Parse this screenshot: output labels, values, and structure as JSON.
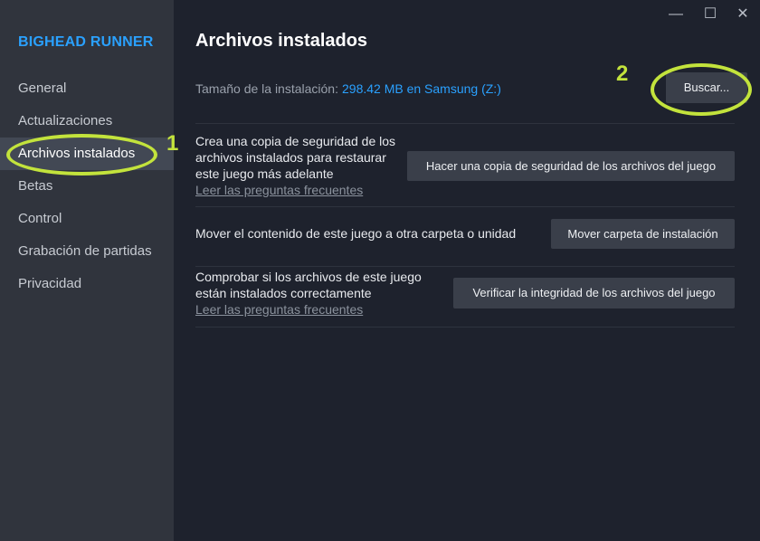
{
  "app": {
    "title": "BIGHEAD RUNNER"
  },
  "sidebar": {
    "items": [
      {
        "label": "General"
      },
      {
        "label": "Actualizaciones"
      },
      {
        "label": "Archivos instalados"
      },
      {
        "label": "Betas"
      },
      {
        "label": "Control"
      },
      {
        "label": "Grabación de partidas"
      },
      {
        "label": "Privacidad"
      }
    ],
    "active_index": 2
  },
  "window_controls": {
    "minimize": "—",
    "maximize": "☐",
    "close": "✕"
  },
  "main": {
    "title": "Archivos instalados",
    "install_size_label": "Tamaño de la instalación:",
    "install_size_value": "298.42 MB en Samsung (Z:)",
    "browse_button": "Buscar...",
    "sections": [
      {
        "text": "Crea una copia de seguridad de los archivos instalados para restaurar este juego más adelante",
        "link": "Leer las preguntas frecuentes",
        "button": "Hacer una copia de seguridad de los archivos del juego"
      },
      {
        "text": "Mover el contenido de este juego a otra carpeta o unidad",
        "button": "Mover carpeta de instalación"
      },
      {
        "text": "Comprobar si los archivos de este juego están instalados correctamente",
        "link": "Leer las preguntas frecuentes",
        "button": "Verificar la integridad de los archivos del juego"
      }
    ]
  },
  "annotations": {
    "step1": "1",
    "step2": "2",
    "color": "#c3e33c"
  },
  "colors": {
    "accent": "#2aa1ff",
    "sidebar_bg": "#30343d",
    "main_bg": "#1e222d"
  }
}
